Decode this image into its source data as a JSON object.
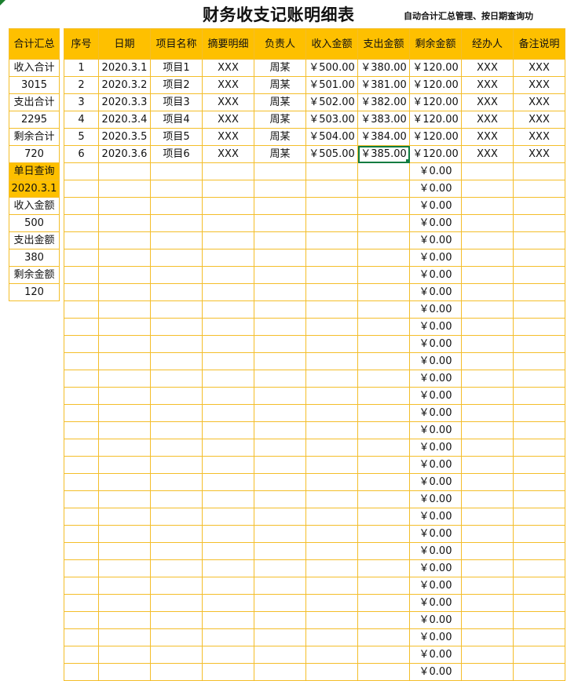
{
  "sheet": {
    "title": "财务收支记账明细表",
    "subtitle": "自动合计汇总管理、按日期查询功"
  },
  "summary": {
    "header": "合计汇总",
    "income_total_label": "收入合计",
    "income_total_value": "3015",
    "expense_total_label": "支出合计",
    "expense_total_value": "2295",
    "balance_total_label": "剩余合计",
    "balance_total_value": "720",
    "daily_query_label": "单日查询",
    "daily_query_date": "2020.3.1",
    "daily_income_label": "收入金额",
    "daily_income_value": "500",
    "daily_expense_label": "支出金额",
    "daily_expense_value": "380",
    "daily_balance_label": "剩余金额",
    "daily_balance_value": "120"
  },
  "table": {
    "headers": [
      "序号",
      "日期",
      "项目名称",
      "摘要明细",
      "负责人",
      "收入金额",
      "支出金额",
      "剩余金额",
      "经办人",
      "备注说明"
    ],
    "rows": [
      [
        "1",
        "2020.3.1",
        "项目1",
        "XXX",
        "周某",
        "￥500.00",
        "￥380.00",
        "￥120.00",
        "XXX",
        "XXX"
      ],
      [
        "2",
        "2020.3.2",
        "项目2",
        "XXX",
        "周某",
        "￥501.00",
        "￥381.00",
        "￥120.00",
        "XXX",
        "XXX"
      ],
      [
        "3",
        "2020.3.3",
        "项目3",
        "XXX",
        "周某",
        "￥502.00",
        "￥382.00",
        "￥120.00",
        "XXX",
        "XXX"
      ],
      [
        "4",
        "2020.3.4",
        "项目4",
        "XXX",
        "周某",
        "￥503.00",
        "￥383.00",
        "￥120.00",
        "XXX",
        "XXX"
      ],
      [
        "5",
        "2020.3.5",
        "项目5",
        "XXX",
        "周某",
        "￥504.00",
        "￥384.00",
        "￥120.00",
        "XXX",
        "XXX"
      ],
      [
        "6",
        "2020.3.6",
        "项目6",
        "XXX",
        "周某",
        "￥505.00",
        "￥385.00",
        "￥120.00",
        "XXX",
        "XXX"
      ]
    ],
    "empty_balance": "￥0.00",
    "empty_row_count": 30
  },
  "colors": {
    "header_fill": "#fec000",
    "grid": "#f4be2a",
    "selection": "#107c41"
  }
}
